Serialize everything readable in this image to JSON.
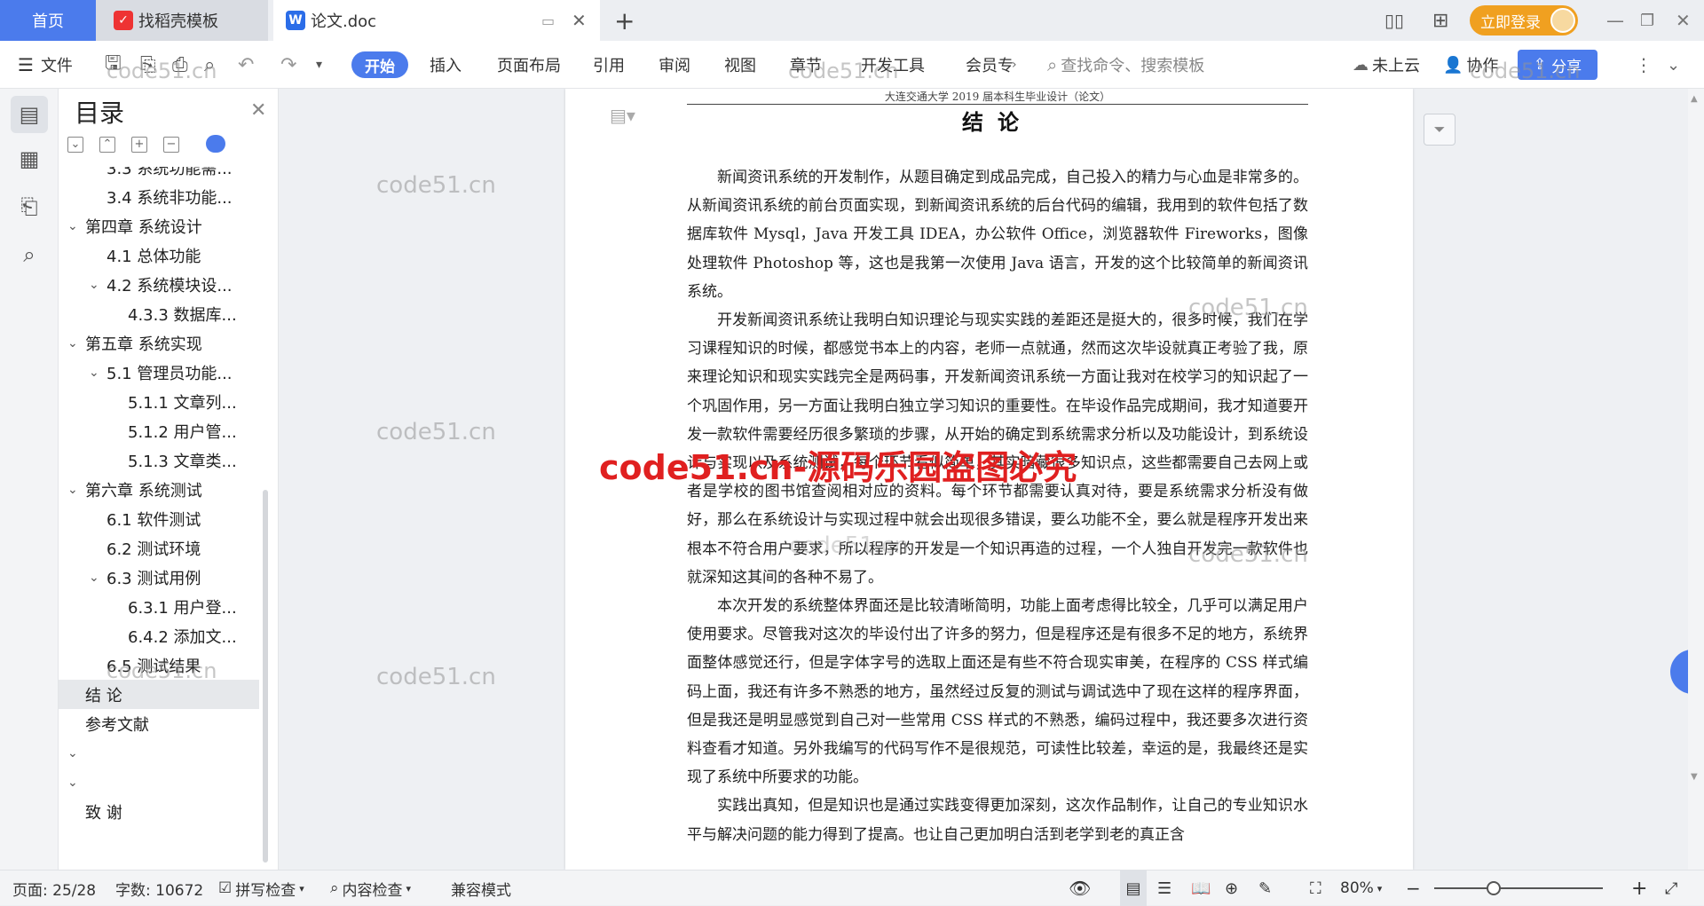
{
  "tabs": {
    "home": "首页",
    "daoke": "找稻壳模板",
    "doc": "论文.doc",
    "login": "立即登录"
  },
  "toolbar": {
    "file": "文件",
    "ribbon": [
      "开始",
      "插入",
      "页面布局",
      "引用",
      "审阅",
      "视图",
      "章节",
      "开发工具",
      "会员专"
    ],
    "search_placeholder": "查找命令、搜索模板",
    "cloud": "未上云",
    "collab": "协作",
    "share": "分享"
  },
  "toc": {
    "title": "目录",
    "items": [
      {
        "label": "3.3 系统功能需...",
        "level": 2,
        "chev": ""
      },
      {
        "label": "3.4 系统非功能...",
        "level": 2,
        "chev": ""
      },
      {
        "label": "第四章 系统设计",
        "level": 1,
        "chev": "v"
      },
      {
        "label": "4.1 总体功能",
        "level": 2,
        "chev": ""
      },
      {
        "label": "4.2 系统模块设...",
        "level": 2,
        "chev": "v"
      },
      {
        "label": "4.3.3 数据库...",
        "level": 3,
        "chev": ""
      },
      {
        "label": "第五章 系统实现",
        "level": 1,
        "chev": "v"
      },
      {
        "label": "5.1 管理员功能...",
        "level": 2,
        "chev": "v"
      },
      {
        "label": "5.1.1 文章列...",
        "level": 3,
        "chev": ""
      },
      {
        "label": "5.1.2 用户管...",
        "level": 3,
        "chev": ""
      },
      {
        "label": "5.1.3 文章类...",
        "level": 3,
        "chev": ""
      },
      {
        "label": "第六章 系统测试",
        "level": 1,
        "chev": "v"
      },
      {
        "label": "6.1 软件测试",
        "level": 2,
        "chev": ""
      },
      {
        "label": "6.2 测试环境",
        "level": 2,
        "chev": ""
      },
      {
        "label": "6.3 测试用例",
        "level": 2,
        "chev": "v"
      },
      {
        "label": "6.3.1 用户登...",
        "level": 3,
        "chev": ""
      },
      {
        "label": "6.4.2 添加文...",
        "level": 3,
        "chev": ""
      },
      {
        "label": "6.5 测试结果",
        "level": 2,
        "chev": ""
      },
      {
        "label": "结 论",
        "level": 1,
        "chev": "",
        "selected": true
      },
      {
        "label": "参考文献",
        "level": 1,
        "chev": ""
      },
      {
        "label": "",
        "level": 1,
        "chev": "v"
      },
      {
        "label": "",
        "level": 1,
        "chev": "v"
      },
      {
        "label": "致 谢",
        "level": 1,
        "chev": ""
      }
    ]
  },
  "document": {
    "running_head": "大连交通大学 2019 届本科生毕业设计（论文）",
    "heading": "结论",
    "paragraphs": [
      "新闻资讯系统的开发制作，从题目确定到成品完成，自己投入的精力与心血是非常多的。从新闻资讯系统的前台页面实现，到新闻资讯系统的后台代码的编辑，我用到的软件包括了数据库软件 Mysql，Java 开发工具 IDEA，办公软件 Office，浏览器软件 Fireworks，图像处理软件 Photoshop 等，这也是我第一次使用 Java 语言，开发的这个比较简单的新闻资讯系统。",
      "开发新闻资讯系统让我明白知识理论与现实实践的差距还是挺大的，很多时候，我们在学习课程知识的时候，都感觉书本上的内容，老师一点就通，然而这次毕设就真正考验了我，原来理论知识和现实实践完全是两码事，开发新闻资讯系统一方面让我对在校学习的知识起了一个巩固作用，另一方面让我明白独立学习知识的重要性。在毕设作品完成期间，我才知道要开发一款软件需要经历很多繁琐的步骤，从开始的确定到系统需求分析以及功能设计，到系统设计与实现以及系统测试，每个环节看似简单，其实暗藏很多知识点，这些都需要自己去网上或者是学校的图书馆查阅相对应的资料。每个环节都需要认真对待，要是系统需求分析没有做好，那么在系统设计与实现过程中就会出现很多错误，要么功能不全，要么就是程序开发出来根本不符合用户要求，所以程序的开发是一个知识再造的过程，一个人独自开发完一款软件也就深知这其间的各种不易了。",
      "本次开发的系统整体界面还是比较清晰简明，功能上面考虑得比较全，几乎可以满足用户使用要求。尽管我对这次的毕设付出了许多的努力，但是程序还是有很多不足的地方，系统界面整体感觉还行，但是字体字号的选取上面还是有些不符合现实审美，在程序的 CSS 样式编码上面，我还有许多不熟悉的地方，虽然经过反复的测试与调试选中了现在这样的程序界面，但是我还是明显感觉到自己对一些常用 CSS 样式的不熟悉，编码过程中，我还要多次进行资料查看才知道。另外我编写的代码写作不是很规范，可读性比较差，幸运的是，我最终还是实现了系统中所要求的功能。",
      "实践出真知，但是知识也是通过实践变得更加深刻，这次作品制作，让自己的专业知识水平与解决问题的能力得到了提高。也让自己更加明白活到老学到老的真正含"
    ]
  },
  "watermarks": {
    "gray": "code51.cn",
    "red": "code51.cn-源码乐园盗图必究"
  },
  "status": {
    "page": "页面: 25/28",
    "words": "字数: 10672",
    "spell": "拼写检查",
    "content_check": "内容检查",
    "compat": "兼容模式",
    "zoom": "80%",
    "zoom_level": 0.35
  },
  "colors": {
    "accent": "#4b7bec",
    "login": "#f0a020",
    "red_watermark": "#e02020"
  }
}
